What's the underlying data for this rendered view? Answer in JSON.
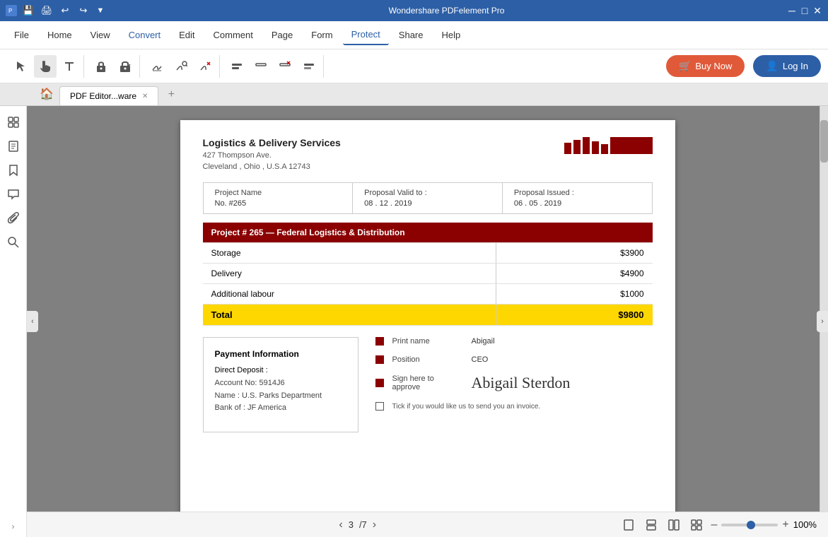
{
  "titlebar": {
    "title": "Wondershare PDFelement Pro",
    "icons": [
      "save-icon",
      "print-icon",
      "undo-icon",
      "redo-icon",
      "dropdown-icon"
    ]
  },
  "menubar": {
    "items": [
      {
        "label": "File",
        "active": false
      },
      {
        "label": "Home",
        "active": false
      },
      {
        "label": "View",
        "active": false
      },
      {
        "label": "Convert",
        "active": false,
        "highlight": true
      },
      {
        "label": "Edit",
        "active": false
      },
      {
        "label": "Comment",
        "active": false
      },
      {
        "label": "Page",
        "active": false
      },
      {
        "label": "Form",
        "active": false
      },
      {
        "label": "Protect",
        "active": true
      },
      {
        "label": "Share",
        "active": false
      },
      {
        "label": "Help",
        "active": false
      }
    ]
  },
  "toolbar": {
    "buy_now_label": "Buy Now",
    "login_label": "Log In"
  },
  "tabs": {
    "home_tooltip": "Home",
    "tab_label": "PDF Editor...ware",
    "add_tooltip": "New Tab"
  },
  "status_bar": {
    "prev_arrow": "‹",
    "current_page": "3",
    "total_pages": "/7",
    "next_arrow": "›",
    "zoom_level": "100%",
    "zoom_minus": "–",
    "zoom_plus": "+"
  },
  "pdf": {
    "company_name": "Logistics & Delivery Services",
    "address_line1": "427 Thompson Ave.",
    "address_line2": "Cleveland , Ohio , U.S.A 12743",
    "project_meta": [
      {
        "label": "Project Name",
        "value": ""
      },
      {
        "label": "Proposal Valid to :",
        "value": "08 . 12 . 2019"
      },
      {
        "label": "Proposal Issued :",
        "value": "06 . 05 . 2019"
      }
    ],
    "project_no": "No. #265",
    "project_title": "Project # 265 — Federal Logistics & Distribution",
    "line_items": [
      {
        "name": "Storage",
        "amount": "$3900"
      },
      {
        "name": "Delivery",
        "amount": "$4900"
      },
      {
        "name": "Additional labour",
        "amount": "$1000"
      }
    ],
    "total_label": "Total",
    "total_amount": "$9800",
    "payment": {
      "title": "Payment Information",
      "direct_deposit_label": "Direct Deposit :",
      "account": "Account No: 5914J6",
      "name": "Name : U.S. Parks Department",
      "bank": "Bank of : JF America"
    },
    "signature": {
      "print_name_label": "Print name",
      "print_name_value": "Abigail",
      "position_label": "Position",
      "position_value": "CEO",
      "sign_label": "Sign here to approve",
      "sign_value": "Abigail Sterdon",
      "tick_label": "Tick if you would like us to send you an invoice."
    }
  }
}
